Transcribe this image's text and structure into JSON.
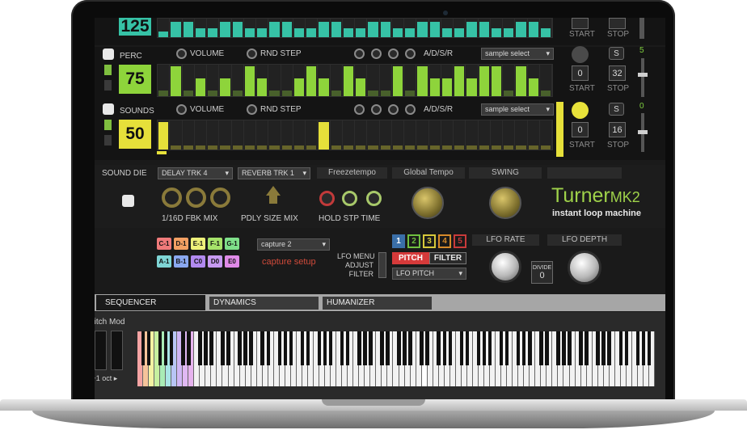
{
  "tracks": [
    {
      "number": "125",
      "color": "#36c2a6",
      "start_label": "START",
      "stop_label": "STOP",
      "steps": [
        0.35,
        0.9,
        0.9,
        0.5,
        0.5,
        0.9,
        0.9,
        0.5,
        0.5,
        0.9,
        0.9,
        0.5,
        0.5,
        0.9,
        0.9,
        0.5,
        0.5,
        0.9,
        0.9,
        0.5,
        0.5,
        0.9,
        0.9,
        0.5,
        0.5,
        0.9,
        0.9,
        0.5,
        0.5,
        0.9,
        0.9,
        0.5
      ]
    },
    {
      "name": "PERC",
      "number": "75",
      "color": "#8ed43b",
      "volume_label": "VOLUME",
      "rnd_label": "RND STEP",
      "adsr_label": "A/D/S/R",
      "sample_select": "sample select",
      "start_value": "0",
      "stop_value": "32",
      "start_label": "START",
      "stop_label": "STOP",
      "side_value": "5",
      "steps": [
        0.2,
        1.0,
        0.2,
        0.6,
        0.2,
        0.6,
        0.2,
        1.0,
        0.6,
        0.2,
        0.2,
        0.6,
        1.0,
        0.6,
        0.2,
        1.0,
        0.6,
        0.2,
        0.2,
        1.0,
        0.2,
        1.0,
        0.6,
        0.6,
        1.0,
        0.6,
        1.0,
        1.0,
        0.2,
        1.0,
        0.6,
        0.2
      ]
    },
    {
      "name": "SOUNDS",
      "number": "50",
      "color": "#e6e03a",
      "volume_label": "VOLUME",
      "rnd_label": "RND STEP",
      "adsr_label": "A/D/S/R",
      "sample_select": "sample select",
      "start_value": "0",
      "stop_value": "16",
      "start_label": "START",
      "stop_label": "STOP",
      "side_value": "0",
      "steps": [
        1.0,
        0.15,
        0.15,
        0.15,
        0.15,
        0.15,
        0.15,
        0.15,
        0.15,
        0.15,
        0.15,
        0.15,
        0.15,
        1.0,
        0.15,
        0.15,
        0.15,
        0.15,
        0.15,
        0.15,
        0.15,
        0.15,
        0.15,
        0.15,
        0.15,
        0.15,
        0.15,
        0.15,
        0.15,
        0.15,
        0.15,
        0.15
      ]
    }
  ],
  "fx": {
    "sound_die": "SOUND DIE",
    "delay": "DELAY TRK 4",
    "delay_knobs": "1/16D FBK  MIX",
    "reverb": "REVERB TRK 1",
    "reverb_knobs": "PDLY SIZE MIX",
    "freeze": "Freezetempo",
    "freeze_knobs": "HOLD STP TIME",
    "global_tempo": "Global Tempo",
    "swing": "SWING"
  },
  "brand": {
    "name": "Turner",
    "model": "MK2",
    "tagline": "instant loop machine",
    "color": "#9fd24a"
  },
  "capture": {
    "chips_row1": [
      "C-1",
      "D-1",
      "E-1",
      "F-1",
      "G-1"
    ],
    "chips_row1_colors": [
      "#f07a7a",
      "#f3a063",
      "#eef07a",
      "#a6e36a",
      "#7fe08a"
    ],
    "chips_row2": [
      "A-1",
      "B-1",
      "C0",
      "D0",
      "E0"
    ],
    "chips_row2_colors": [
      "#7fd6d6",
      "#8aa8f0",
      "#b28af0",
      "#c89af2",
      "#e08ae8"
    ],
    "select": "capture 2",
    "setup": "capture setup"
  },
  "lfo": {
    "menu_label_1": "LFO MENU",
    "menu_label_2": "ADJUST",
    "menu_label_3": "FILTER",
    "tabs": [
      "1",
      "2",
      "3",
      "4",
      "5"
    ],
    "tab_colors": [
      "#3a6fa8",
      "#6fbf3f",
      "#d6c83a",
      "#d68a2a",
      "#c83a3a"
    ],
    "pitch": "PITCH",
    "filter": "FILTER",
    "select": "LFO PITCH",
    "rate_label": "LFO RATE",
    "depth_label": "LFO DEPTH",
    "divide_label": "DIVIDE",
    "divide_value": "0"
  },
  "tabs": [
    "SEQUENCER",
    "DYNAMICS",
    "HUMANIZER"
  ],
  "keyboard": {
    "pitch_mod": "Pitch Mod",
    "octave": "◂+1 oct ▸"
  }
}
